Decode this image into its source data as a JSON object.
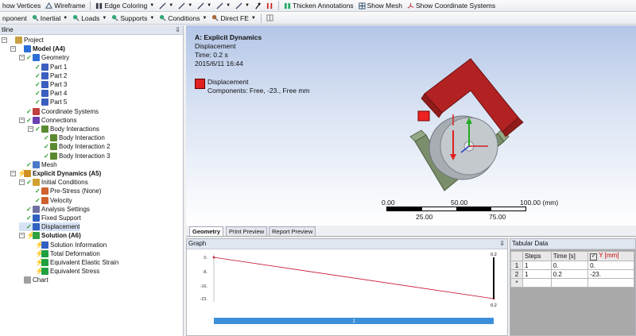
{
  "toolbar1": {
    "show_vertices": "how Vertices",
    "wireframe": "Wireframe",
    "edge_coloring": "Edge Coloring",
    "thicken_annotations": "Thicken Annotations",
    "show_mesh": "Show Mesh",
    "show_coordinate_systems": "Show Coordinate Systems"
  },
  "toolbar2": {
    "component": "nponent",
    "inertial": "Inertial",
    "loads": "Loads",
    "supports": "Supports",
    "conditions": "Conditions",
    "direct_fe": "Direct FE"
  },
  "outline": {
    "title": "tline",
    "pin": "⇩",
    "items": [
      {
        "label": "Project",
        "level": 0,
        "icon": "project-icon",
        "status": ""
      },
      {
        "label": "Model (A4)",
        "level": 1,
        "icon": "model-icon",
        "status": "",
        "bold": true
      },
      {
        "label": "Geometry",
        "level": 2,
        "icon": "geometry-icon",
        "status": "check"
      },
      {
        "label": "Part 1",
        "level": 3,
        "icon": "part-icon",
        "status": "check"
      },
      {
        "label": "Part 2",
        "level": 3,
        "icon": "part-icon",
        "status": "check"
      },
      {
        "label": "Part 3",
        "level": 3,
        "icon": "part-icon",
        "status": "check"
      },
      {
        "label": "Part 4",
        "level": 3,
        "icon": "part-icon",
        "status": "check"
      },
      {
        "label": "Part 5",
        "level": 3,
        "icon": "part-icon",
        "status": "check"
      },
      {
        "label": "Coordinate Systems",
        "level": 2,
        "icon": "coordinate-icon",
        "status": "check"
      },
      {
        "label": "Connections",
        "level": 2,
        "icon": "connections-icon",
        "status": "check"
      },
      {
        "label": "Body Interactions",
        "level": 3,
        "icon": "body-interactions-icon",
        "status": "check"
      },
      {
        "label": "Body Interaction",
        "level": 4,
        "icon": "body-interaction-icon",
        "status": "check"
      },
      {
        "label": "Body Interaction 2",
        "level": 4,
        "icon": "body-interaction-icon",
        "status": "check"
      },
      {
        "label": "Body Interaction 3",
        "level": 4,
        "icon": "body-interaction-icon",
        "status": "check"
      },
      {
        "label": "Mesh",
        "level": 2,
        "icon": "mesh-icon",
        "status": "check"
      },
      {
        "label": "Explicit Dynamics (A5)",
        "level": 1,
        "icon": "analysis-icon",
        "status": "lightning",
        "bold": true
      },
      {
        "label": "Initial Conditions",
        "level": 2,
        "icon": "initial-conditions-icon",
        "status": "check"
      },
      {
        "label": "Pre-Stress (None)",
        "level": 3,
        "icon": "prestress-icon",
        "status": "check"
      },
      {
        "label": "Velocity",
        "level": 3,
        "icon": "velocity-icon",
        "status": "check"
      },
      {
        "label": "Analysis Settings",
        "level": 2,
        "icon": "analysis-settings-icon",
        "status": "check"
      },
      {
        "label": "Fixed Support",
        "level": 2,
        "icon": "fixed-support-icon",
        "status": "check"
      },
      {
        "label": "Displacement",
        "level": 2,
        "icon": "displacement-icon",
        "status": "check",
        "selected": true
      },
      {
        "label": "Solution (A6)",
        "level": 2,
        "icon": "solution-icon",
        "status": "lightning",
        "bold": true
      },
      {
        "label": "Solution Information",
        "level": 3,
        "icon": "solution-information-icon",
        "status": "lightning"
      },
      {
        "label": "Total Deformation",
        "level": 3,
        "icon": "result-icon",
        "status": "lightning"
      },
      {
        "label": "Equivalent Elastic Strain",
        "level": 3,
        "icon": "result-icon",
        "status": "lightning"
      },
      {
        "label": "Equivalent Stress",
        "level": 3,
        "icon": "result-icon",
        "status": "lightning"
      },
      {
        "label": "Chart",
        "level": 1,
        "icon": "chart-icon",
        "status": ""
      }
    ]
  },
  "viewport": {
    "title": "A: Explicit Dynamics",
    "subtitle": "Displacement",
    "time": "Time: 0.2 s",
    "date": "2015/6/11 16:44",
    "legend_label": "Displacement",
    "legend_components": "Components: Free, -23., Free mm",
    "legend_color": "#e02020",
    "scale_top": [
      "0.00",
      "50.00",
      "100.00 (mm)"
    ],
    "scale_bottom": [
      "25.00",
      "75.00"
    ]
  },
  "tabs": [
    "Geometry",
    "Print Preview",
    "Report Preview"
  ],
  "graph": {
    "title": "Graph",
    "pin": "⇩",
    "y_ticks": [
      "0.",
      "-8.",
      "-16.",
      "-23."
    ],
    "x_label_top": "0.2",
    "x_label_bottom": "0.2",
    "step_label": "1"
  },
  "tabular": {
    "title": "Tabular Data",
    "headers": [
      "Steps",
      "Time [s]",
      "Y [mm]"
    ],
    "rows": [
      {
        "num": "1",
        "steps": "1",
        "time": "0.",
        "y": "0."
      },
      {
        "num": "2",
        "steps": "1",
        "time": "0.2",
        "y": "-23."
      },
      {
        "num": "*",
        "steps": "",
        "time": "",
        "y": ""
      }
    ]
  },
  "chart_data": {
    "type": "line",
    "x": [
      0,
      0.2
    ],
    "y": [
      0,
      -23
    ],
    "ylim": [
      -23,
      0
    ],
    "yticks": [
      0,
      -8,
      -16,
      -23
    ],
    "series": [
      {
        "values": [
          0,
          -23
        ]
      }
    ]
  },
  "colors": {
    "part_red": "#b22222",
    "part_green": "#7a8e6b",
    "part_grey": "#b4b8bd",
    "graph_line": "#c8102e",
    "step_bar": "#3c8fd9"
  }
}
